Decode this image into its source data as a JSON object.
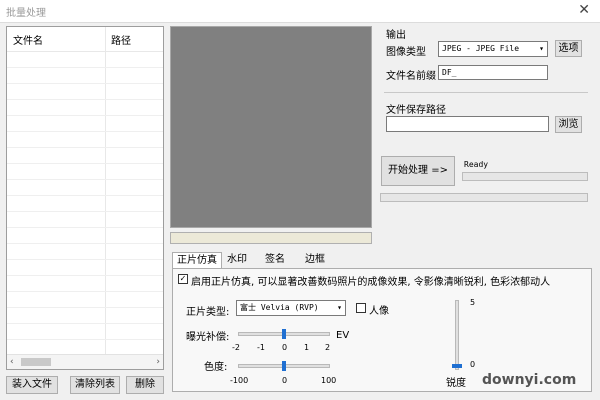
{
  "window": {
    "title": "批量处理",
    "close_glyph": "✕"
  },
  "file_list": {
    "columns": [
      "文件名",
      "路径"
    ],
    "scroll_left": "‹",
    "scroll_right": "›"
  },
  "left_buttons": [
    "装入文件",
    "清除列表",
    "删除"
  ],
  "output": {
    "section_label": "输出",
    "image_type_label": "图像类型",
    "image_type_value": "JPEG - JPEG File",
    "options_button": "选项",
    "prefix_label": "文件名前缀",
    "prefix_value": "DF_",
    "save_path_label": "文件保存路径",
    "save_path_value": "",
    "browse_button": "浏览"
  },
  "process": {
    "start_button": "开始处理 =>",
    "status": "Ready",
    "progress_fraction": 0
  },
  "tabs": [
    "正片仿真",
    "水印",
    "签名",
    "边框"
  ],
  "active_tab": 0,
  "positive_sim": {
    "enable_checked": true,
    "enable_label": "启用正片仿真, 可以显著改善数码照片的成像效果, 令影像清晰锐利, 色彩浓郁动人",
    "film_type_label": "正片类型:",
    "film_type_value": "富士 Velvia (RVP)",
    "portrait_label": "人像",
    "portrait_checked": false,
    "exposure_label": "曝光补偿:",
    "exposure_ticks": [
      "-2",
      "-1",
      "0",
      "1",
      "2"
    ],
    "exposure_unit": "EV",
    "exposure_value": 0,
    "saturation_label": "色度:",
    "saturation_ticks": [
      "-100",
      "0",
      "100"
    ],
    "saturation_value": 0,
    "vertical_max": "5",
    "vertical_min": "0",
    "vertical_label": "锐度",
    "vertical_value": 0
  },
  "watermark_text": "downyi.com"
}
